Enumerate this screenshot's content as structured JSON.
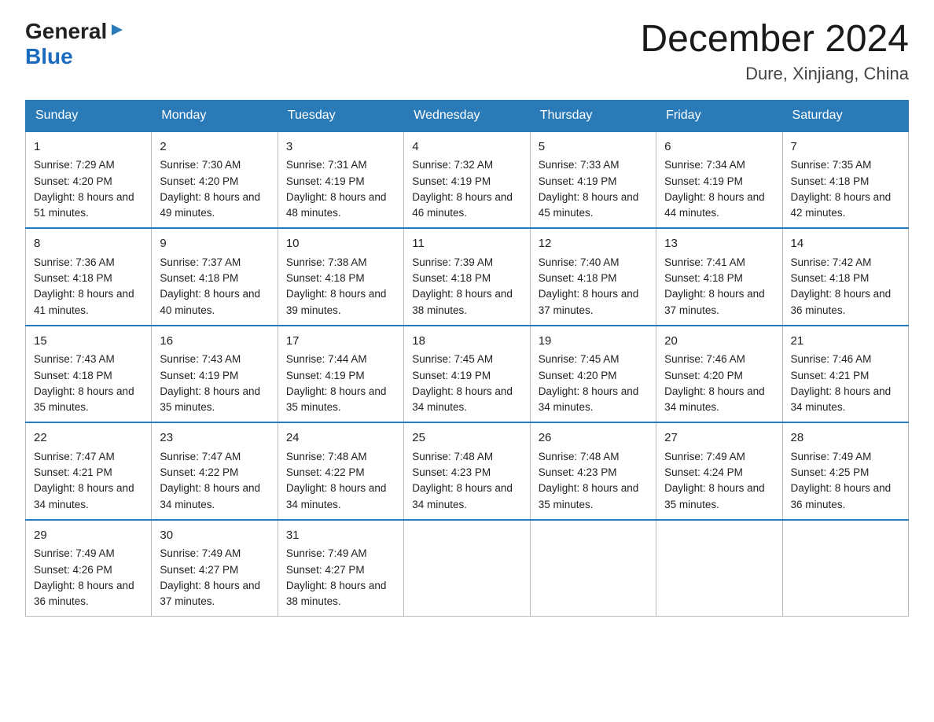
{
  "logo": {
    "general": "General",
    "blue": "Blue",
    "triangle": "▶"
  },
  "title": "December 2024",
  "location": "Dure, Xinjiang, China",
  "days_of_week": [
    "Sunday",
    "Monday",
    "Tuesday",
    "Wednesday",
    "Thursday",
    "Friday",
    "Saturday"
  ],
  "weeks": [
    [
      {
        "day": "1",
        "sunrise": "7:29 AM",
        "sunset": "4:20 PM",
        "daylight": "8 hours and 51 minutes."
      },
      {
        "day": "2",
        "sunrise": "7:30 AM",
        "sunset": "4:20 PM",
        "daylight": "8 hours and 49 minutes."
      },
      {
        "day": "3",
        "sunrise": "7:31 AM",
        "sunset": "4:19 PM",
        "daylight": "8 hours and 48 minutes."
      },
      {
        "day": "4",
        "sunrise": "7:32 AM",
        "sunset": "4:19 PM",
        "daylight": "8 hours and 46 minutes."
      },
      {
        "day": "5",
        "sunrise": "7:33 AM",
        "sunset": "4:19 PM",
        "daylight": "8 hours and 45 minutes."
      },
      {
        "day": "6",
        "sunrise": "7:34 AM",
        "sunset": "4:19 PM",
        "daylight": "8 hours and 44 minutes."
      },
      {
        "day": "7",
        "sunrise": "7:35 AM",
        "sunset": "4:18 PM",
        "daylight": "8 hours and 42 minutes."
      }
    ],
    [
      {
        "day": "8",
        "sunrise": "7:36 AM",
        "sunset": "4:18 PM",
        "daylight": "8 hours and 41 minutes."
      },
      {
        "day": "9",
        "sunrise": "7:37 AM",
        "sunset": "4:18 PM",
        "daylight": "8 hours and 40 minutes."
      },
      {
        "day": "10",
        "sunrise": "7:38 AM",
        "sunset": "4:18 PM",
        "daylight": "8 hours and 39 minutes."
      },
      {
        "day": "11",
        "sunrise": "7:39 AM",
        "sunset": "4:18 PM",
        "daylight": "8 hours and 38 minutes."
      },
      {
        "day": "12",
        "sunrise": "7:40 AM",
        "sunset": "4:18 PM",
        "daylight": "8 hours and 37 minutes."
      },
      {
        "day": "13",
        "sunrise": "7:41 AM",
        "sunset": "4:18 PM",
        "daylight": "8 hours and 37 minutes."
      },
      {
        "day": "14",
        "sunrise": "7:42 AM",
        "sunset": "4:18 PM",
        "daylight": "8 hours and 36 minutes."
      }
    ],
    [
      {
        "day": "15",
        "sunrise": "7:43 AM",
        "sunset": "4:18 PM",
        "daylight": "8 hours and 35 minutes."
      },
      {
        "day": "16",
        "sunrise": "7:43 AM",
        "sunset": "4:19 PM",
        "daylight": "8 hours and 35 minutes."
      },
      {
        "day": "17",
        "sunrise": "7:44 AM",
        "sunset": "4:19 PM",
        "daylight": "8 hours and 35 minutes."
      },
      {
        "day": "18",
        "sunrise": "7:45 AM",
        "sunset": "4:19 PM",
        "daylight": "8 hours and 34 minutes."
      },
      {
        "day": "19",
        "sunrise": "7:45 AM",
        "sunset": "4:20 PM",
        "daylight": "8 hours and 34 minutes."
      },
      {
        "day": "20",
        "sunrise": "7:46 AM",
        "sunset": "4:20 PM",
        "daylight": "8 hours and 34 minutes."
      },
      {
        "day": "21",
        "sunrise": "7:46 AM",
        "sunset": "4:21 PM",
        "daylight": "8 hours and 34 minutes."
      }
    ],
    [
      {
        "day": "22",
        "sunrise": "7:47 AM",
        "sunset": "4:21 PM",
        "daylight": "8 hours and 34 minutes."
      },
      {
        "day": "23",
        "sunrise": "7:47 AM",
        "sunset": "4:22 PM",
        "daylight": "8 hours and 34 minutes."
      },
      {
        "day": "24",
        "sunrise": "7:48 AM",
        "sunset": "4:22 PM",
        "daylight": "8 hours and 34 minutes."
      },
      {
        "day": "25",
        "sunrise": "7:48 AM",
        "sunset": "4:23 PM",
        "daylight": "8 hours and 34 minutes."
      },
      {
        "day": "26",
        "sunrise": "7:48 AM",
        "sunset": "4:23 PM",
        "daylight": "8 hours and 35 minutes."
      },
      {
        "day": "27",
        "sunrise": "7:49 AM",
        "sunset": "4:24 PM",
        "daylight": "8 hours and 35 minutes."
      },
      {
        "day": "28",
        "sunrise": "7:49 AM",
        "sunset": "4:25 PM",
        "daylight": "8 hours and 36 minutes."
      }
    ],
    [
      {
        "day": "29",
        "sunrise": "7:49 AM",
        "sunset": "4:26 PM",
        "daylight": "8 hours and 36 minutes."
      },
      {
        "day": "30",
        "sunrise": "7:49 AM",
        "sunset": "4:27 PM",
        "daylight": "8 hours and 37 minutes."
      },
      {
        "day": "31",
        "sunrise": "7:49 AM",
        "sunset": "4:27 PM",
        "daylight": "8 hours and 38 minutes."
      },
      null,
      null,
      null,
      null
    ]
  ],
  "labels": {
    "sunrise_prefix": "Sunrise: ",
    "sunset_prefix": "Sunset: ",
    "daylight_prefix": "Daylight: "
  }
}
